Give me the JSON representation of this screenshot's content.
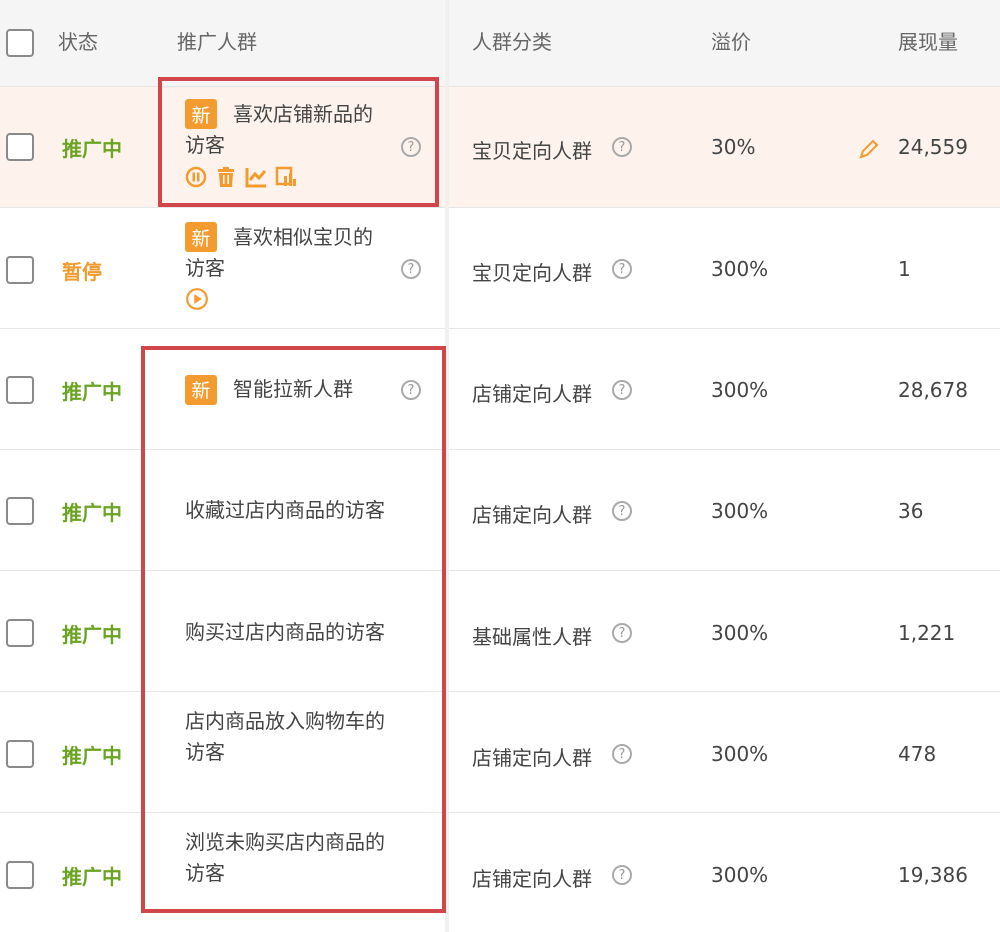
{
  "header": {
    "status": "状态",
    "crowd": "推广人群",
    "category": "人群分类",
    "premium": "溢价",
    "impressions": "展现量"
  },
  "badge_label": "新",
  "help_glyph": "?",
  "rows": [
    {
      "status": "推广中",
      "status_type": "active",
      "crowd_line1": "喜欢店铺新品的",
      "crowd_line2": "访客",
      "is_new": true,
      "category": "宝贝定向人群",
      "premium": "30%",
      "impressions": "24,559"
    },
    {
      "status": "暂停",
      "status_type": "paused",
      "crowd_line1": "喜欢相似宝贝的",
      "crowd_line2": "访客",
      "is_new": true,
      "category": "宝贝定向人群",
      "premium": "300%",
      "impressions": "1"
    },
    {
      "status": "推广中",
      "status_type": "active",
      "crowd_line1": "智能拉新人群",
      "crowd_line2": "",
      "is_new": true,
      "category": "店铺定向人群",
      "premium": "300%",
      "impressions": "28,678"
    },
    {
      "status": "推广中",
      "status_type": "active",
      "crowd_line1": "收藏过店内商品的访客",
      "crowd_line2": "",
      "is_new": false,
      "category": "店铺定向人群",
      "premium": "300%",
      "impressions": "36"
    },
    {
      "status": "推广中",
      "status_type": "active",
      "crowd_line1": "购买过店内商品的访客",
      "crowd_line2": "",
      "is_new": false,
      "category": "基础属性人群",
      "premium": "300%",
      "impressions": "1,221"
    },
    {
      "status": "推广中",
      "status_type": "active",
      "crowd_line1": "店内商品放入购物车的",
      "crowd_line2": "访客",
      "is_new": false,
      "category": "店铺定向人群",
      "premium": "300%",
      "impressions": "478"
    },
    {
      "status": "推广中",
      "status_type": "active",
      "crowd_line1": "浏览未购买店内商品的",
      "crowd_line2": "访客",
      "is_new": false,
      "category": "店铺定向人群",
      "premium": "300%",
      "impressions": "19,386"
    }
  ],
  "icons": {
    "pause": "pause-icon",
    "delete": "trash-icon",
    "chart": "trend-chart-icon",
    "report": "report-icon",
    "play": "play-icon",
    "edit": "pencil-icon",
    "help": "question-icon"
  },
  "colors": {
    "active": "#6aa422",
    "paused": "#f29b2d",
    "badge": "#f39b2e",
    "highlight_row": "#fdf3ec",
    "annotation": "#d0464a"
  }
}
